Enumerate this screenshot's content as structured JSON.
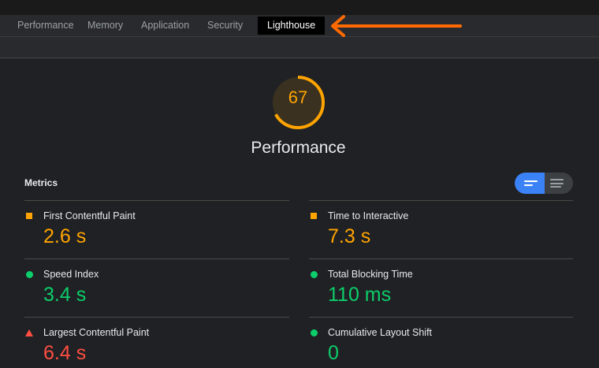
{
  "tabs": [
    {
      "label": "Performance"
    },
    {
      "label": "Memory"
    },
    {
      "label": "Application"
    },
    {
      "label": "Security"
    },
    {
      "label": "Lighthouse",
      "active": true
    }
  ],
  "report": {
    "score": "67",
    "score_value": 67,
    "category_title": "Performance",
    "metrics_label": "Metrics"
  },
  "metrics": [
    {
      "name": "First Contentful Paint",
      "value": "2.6 s",
      "status": "average",
      "indicator": "square-icon"
    },
    {
      "name": "Time to Interactive",
      "value": "7.3 s",
      "status": "average",
      "indicator": "square-icon"
    },
    {
      "name": "Speed Index",
      "value": "3.4 s",
      "status": "pass",
      "indicator": "circle-icon"
    },
    {
      "name": "Total Blocking Time",
      "value": "110 ms",
      "status": "pass",
      "indicator": "circle-icon"
    },
    {
      "name": "Largest Contentful Paint",
      "value": "6.4 s",
      "status": "fail",
      "indicator": "triangle-icon"
    },
    {
      "name": "Cumulative Layout Shift",
      "value": "0",
      "status": "pass",
      "indicator": "circle-icon"
    }
  ],
  "colors": {
    "average": "#ffa400",
    "pass": "#0cce6b",
    "fail": "#ff4e42",
    "toggle_active": "#3b82f6",
    "annotation_arrow": "#ff6a00"
  }
}
